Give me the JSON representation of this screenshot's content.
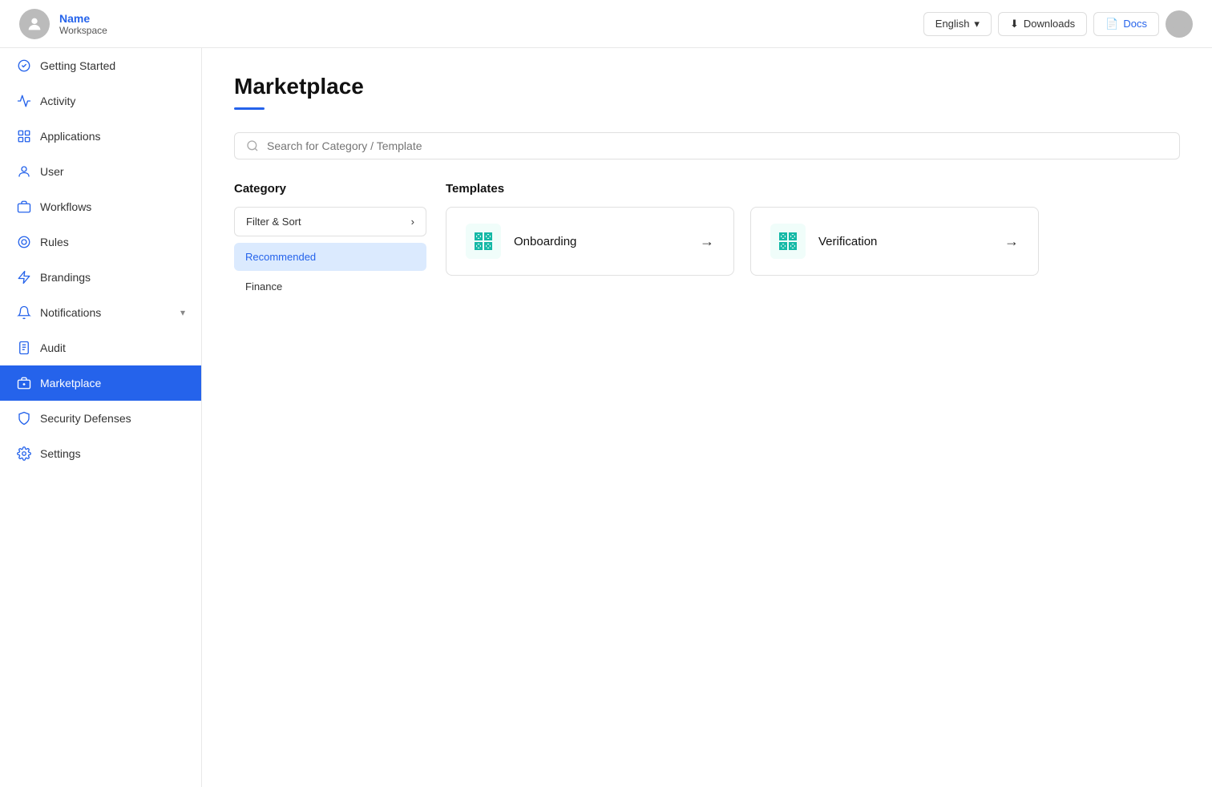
{
  "header": {
    "user_name": "Name",
    "workspace": "Workspace",
    "language_label": "English",
    "downloads_label": "Downloads",
    "docs_label": "Docs"
  },
  "sidebar": {
    "items": [
      {
        "id": "getting-started",
        "label": "Getting Started",
        "icon": "flag",
        "active": false
      },
      {
        "id": "activity",
        "label": "Activity",
        "icon": "activity",
        "active": false
      },
      {
        "id": "applications",
        "label": "Applications",
        "icon": "grid",
        "active": false
      },
      {
        "id": "user",
        "label": "User",
        "icon": "user",
        "active": false
      },
      {
        "id": "workflows",
        "label": "Workflows",
        "icon": "briefcase",
        "active": false
      },
      {
        "id": "rules",
        "label": "Rules",
        "icon": "target",
        "active": false
      },
      {
        "id": "brandings",
        "label": "Brandings",
        "icon": "lightning",
        "active": false
      },
      {
        "id": "notifications",
        "label": "Notifications",
        "icon": "bell",
        "active": false,
        "has_chevron": true
      },
      {
        "id": "audit",
        "label": "Audit",
        "icon": "clipboard",
        "active": false
      },
      {
        "id": "marketplace",
        "label": "Marketplace",
        "icon": "suitcase",
        "active": true
      },
      {
        "id": "security-defenses",
        "label": "Security Defenses",
        "icon": "shield",
        "active": false
      },
      {
        "id": "settings",
        "label": "Settings",
        "icon": "gear",
        "active": false
      }
    ]
  },
  "main": {
    "page_title": "Marketplace",
    "search_placeholder": "Search for Category / Template",
    "category": {
      "title": "Category",
      "filter_sort_label": "Filter & Sort",
      "items": [
        {
          "id": "recommended",
          "label": "Recommended",
          "active": true
        },
        {
          "id": "finance",
          "label": "Finance",
          "active": false
        }
      ]
    },
    "templates": {
      "title": "Templates",
      "items": [
        {
          "id": "onboarding",
          "label": "Onboarding"
        },
        {
          "id": "verification",
          "label": "Verification"
        }
      ]
    }
  }
}
